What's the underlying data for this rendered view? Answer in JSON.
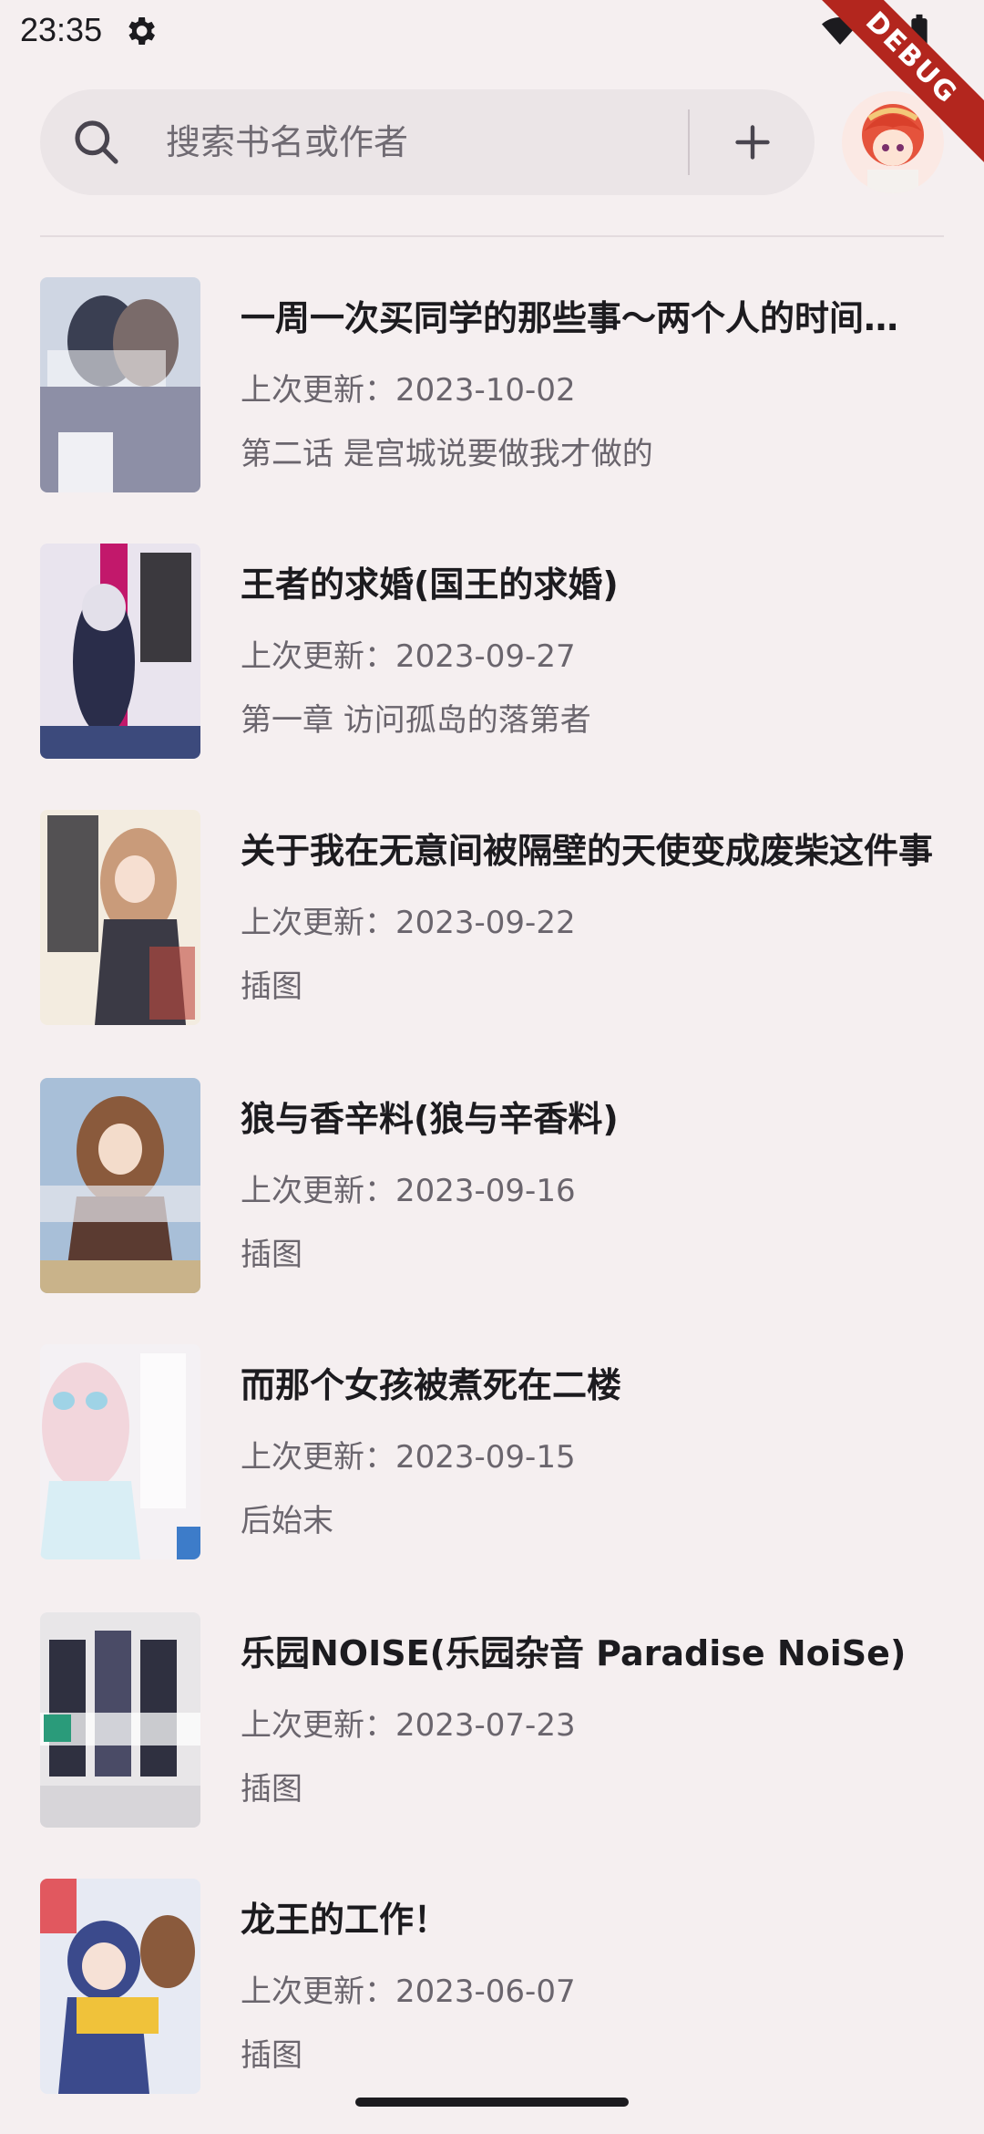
{
  "status_bar": {
    "time": "23:35",
    "debug_label": "DEBUG"
  },
  "search": {
    "placeholder": "搜索书名或作者"
  },
  "books": [
    {
      "title": "一周一次买同学的那些事～两个人的时间，用五千日元作为借口～",
      "updated": "上次更新：2023-10-02",
      "latest_chapter": "第二话 是宫城说要做我才做的",
      "cover_colors": [
        "#cfd6e3",
        "#3a3f52",
        "#8d8fa6"
      ]
    },
    {
      "title": "王者的求婚(国王的求婚)",
      "updated": "上次更新：2023-09-27",
      "latest_chapter": "第一章 访问孤岛的落第者",
      "cover_colors": [
        "#e9e4ee",
        "#c2186b",
        "#2a2d4a"
      ]
    },
    {
      "title": "关于我在无意间被隔壁的天使变成废柴这件事",
      "updated": "上次更新：2023-09-22",
      "latest_chapter": "插图",
      "cover_colors": [
        "#f3ece0",
        "#c99b7a",
        "#3b3a45"
      ]
    },
    {
      "title": "狼与香辛料(狼与辛香料)",
      "updated": "上次更新：2023-09-16",
      "latest_chapter": "插图",
      "cover_colors": [
        "#a8bfd8",
        "#8a5a3c",
        "#5b3b31"
      ]
    },
    {
      "title": "而那个女孩被煮死在二楼",
      "updated": "上次更新：2023-09-15",
      "latest_chapter": "后始末",
      "cover_colors": [
        "#f4f1f4",
        "#9fd3e6",
        "#e8b8c3"
      ]
    },
    {
      "title": "乐园NOISE(乐园杂音 Paradise NoiSe)",
      "updated": "上次更新：2023-07-23",
      "latest_chapter": "插图",
      "cover_colors": [
        "#e8e6e8",
        "#2f3040",
        "#2a9b7a"
      ]
    },
    {
      "title": "龙王的工作！",
      "updated": "上次更新：2023-06-07",
      "latest_chapter": "插图",
      "cover_colors": [
        "#e7eaf3",
        "#3b4a8c",
        "#f0c23a"
      ]
    }
  ],
  "colors": {
    "background": "#f5eff0",
    "search_bar": "#ebe5e7",
    "title_text": "#1c1b1f",
    "secondary_text": "#6a656d",
    "debug_ribbon": "#b3261e"
  }
}
